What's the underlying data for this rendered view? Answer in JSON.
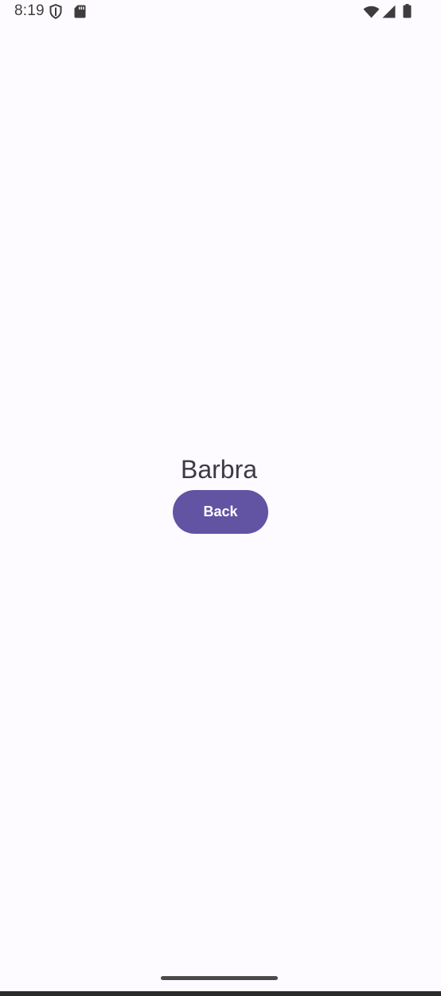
{
  "status_bar": {
    "time": "8:19",
    "icons": [
      "shield-icon",
      "sd-card-icon",
      "wifi-icon",
      "cellular-signal-icon",
      "battery-icon"
    ]
  },
  "main": {
    "name": "Barbra",
    "back_button_label": "Back"
  },
  "colors": {
    "background": "#fdfbff",
    "button": "#6253a3",
    "button_text": "#ffffff",
    "text": "#3d3a45"
  }
}
